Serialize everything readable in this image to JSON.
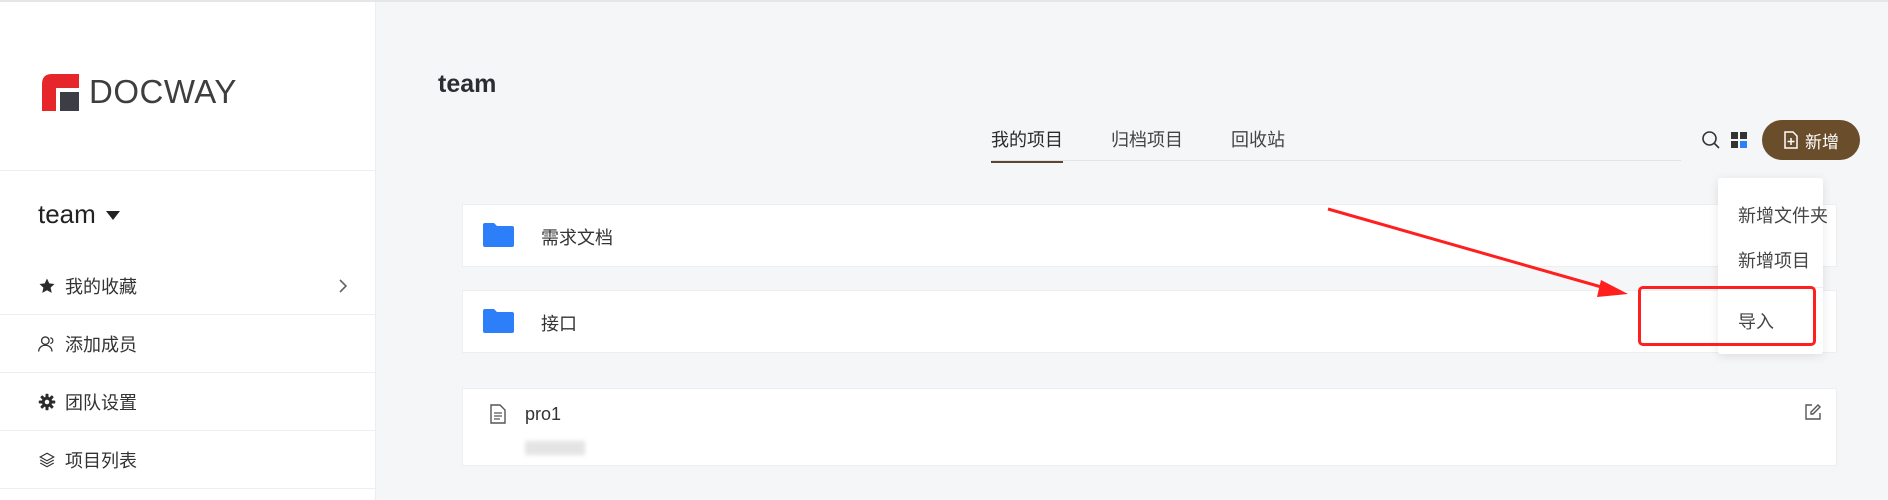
{
  "app": {
    "logo_text": "DOCWAY",
    "brand_color": "#6a4d2b",
    "accent_red": "#e5262b"
  },
  "sidebar": {
    "team_name": "team",
    "items": [
      {
        "label": "我的收藏",
        "icon": "star-icon",
        "has_arrow": true
      },
      {
        "label": "添加成员",
        "icon": "user-icon"
      },
      {
        "label": "团队设置",
        "icon": "gear-icon"
      },
      {
        "label": "项目列表",
        "icon": "layers-icon"
      }
    ]
  },
  "main": {
    "title": "team",
    "tabs": [
      {
        "label": "我的项目",
        "active": true
      },
      {
        "label": "归档项目",
        "active": false
      },
      {
        "label": "回收站",
        "active": false
      }
    ],
    "new_button": "新增",
    "dropdown": {
      "items": [
        "新增文件夹",
        "新增项目",
        "导入"
      ],
      "highlighted": "导入"
    },
    "folders": [
      {
        "name": "需求文档",
        "icon": "folder-icon",
        "color": "#2d7ff9"
      },
      {
        "name": "接口",
        "icon": "folder-icon",
        "color": "#2d7ff9"
      }
    ],
    "projects": [
      {
        "name": "pro1",
        "icon": "document-icon"
      }
    ]
  }
}
